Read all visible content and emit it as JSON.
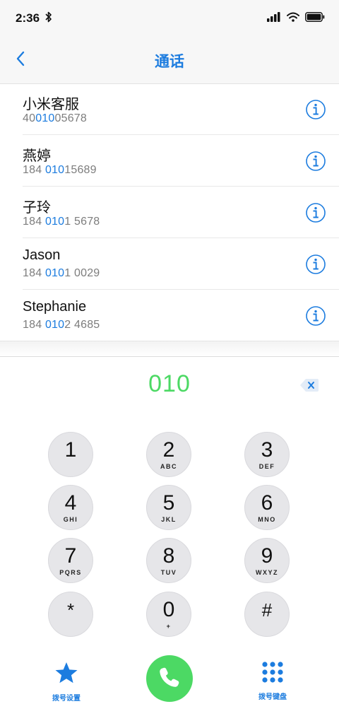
{
  "status_bar": {
    "time": "2:36"
  },
  "nav": {
    "title": "通话"
  },
  "contacts": [
    {
      "name": "小米客服",
      "number_pre": "40",
      "number_match": "010",
      "number_post": "05678"
    },
    {
      "name": "燕婷",
      "number_pre": "184 ",
      "number_match": "010",
      "number_post": "15689"
    },
    {
      "name": "子玲",
      "number_pre": "184 ",
      "number_match": "010",
      "number_post": "1 5678"
    },
    {
      "name": "Jason",
      "number_pre": "184 ",
      "number_match": "010",
      "number_post": "1 0029"
    },
    {
      "name": "Stephanie",
      "number_pre": "184 ",
      "number_match": "010",
      "number_post": "2 4685"
    }
  ],
  "dialer": {
    "input": "010",
    "keys": [
      {
        "digit": "1",
        "letters": ""
      },
      {
        "digit": "2",
        "letters": "ABC"
      },
      {
        "digit": "3",
        "letters": "DEF"
      },
      {
        "digit": "4",
        "letters": "GHI"
      },
      {
        "digit": "5",
        "letters": "JKL"
      },
      {
        "digit": "6",
        "letters": "MNO"
      },
      {
        "digit": "7",
        "letters": "PQRS"
      },
      {
        "digit": "8",
        "letters": "TUV"
      },
      {
        "digit": "9",
        "letters": "WXYZ"
      },
      {
        "digit": "*",
        "letters": ""
      },
      {
        "digit": "0",
        "letters": "+"
      },
      {
        "digit": "#",
        "letters": ""
      }
    ]
  },
  "bottom": {
    "settings_label": "拨号设置",
    "keypad_label": "拨号键盘"
  },
  "colors": {
    "accent": "#1c7cdf",
    "dial_green": "#4cd964",
    "key_bg": "#e6e6e9"
  },
  "icons": {
    "back": "chevron-left-icon",
    "info": "info-circle-icon",
    "delete": "backspace-icon",
    "settings": "star-icon",
    "call": "phone-icon",
    "keypad": "dialpad-grid-icon"
  }
}
